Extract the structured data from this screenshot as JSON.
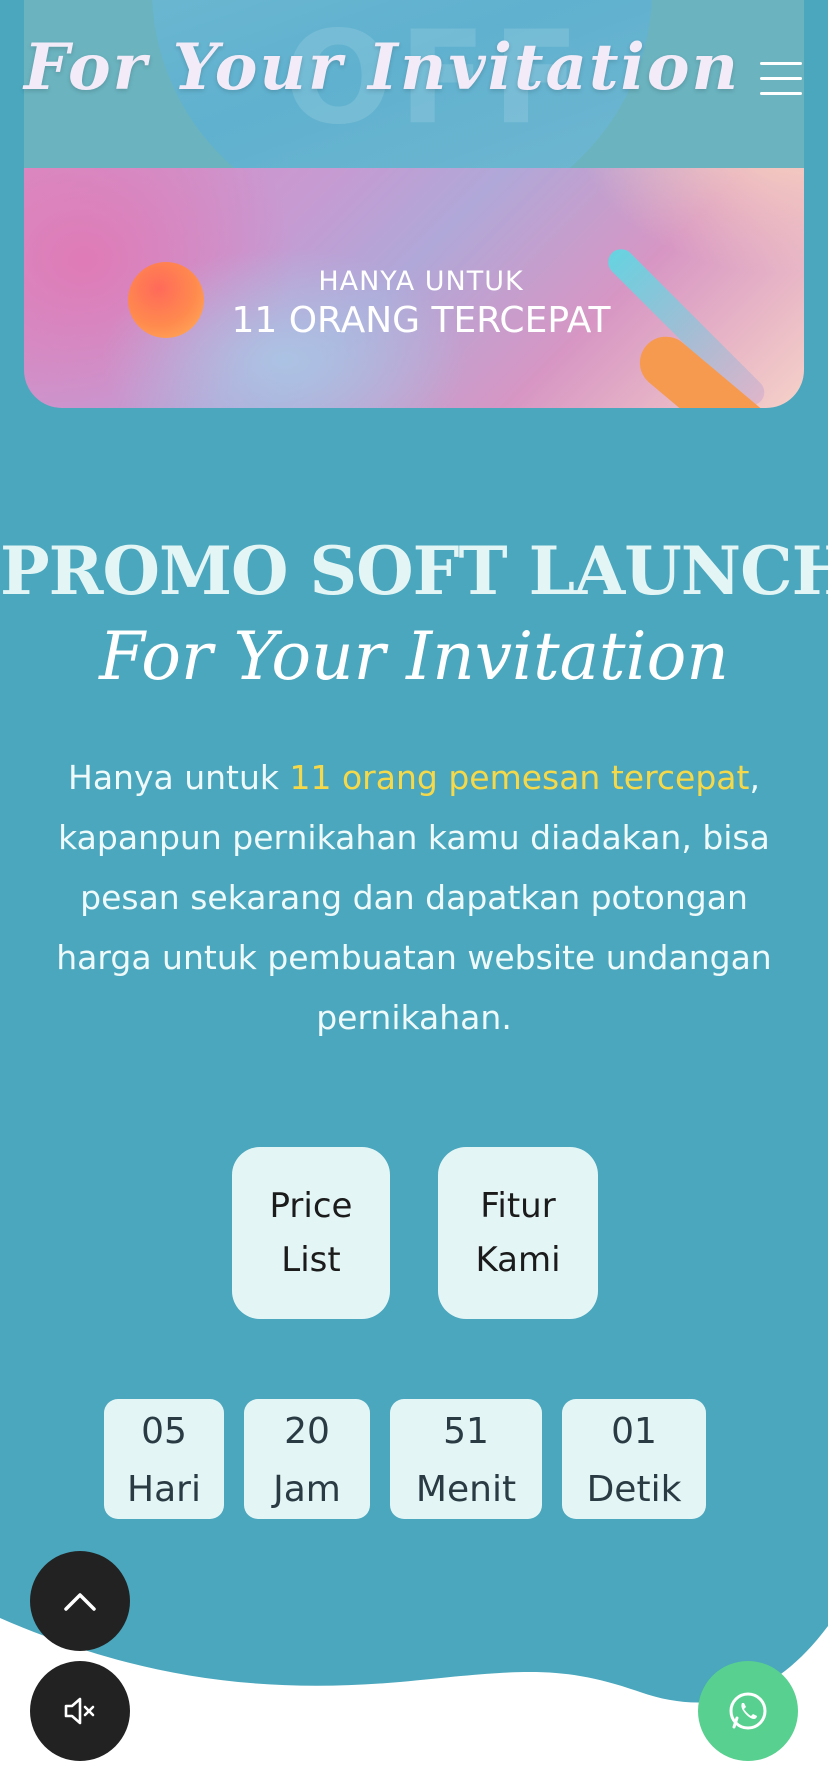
{
  "header": {
    "brand": "For Your Invitation",
    "menu_icon": "hamburger-menu-icon"
  },
  "banner": {
    "background_text": "OFF",
    "small_label": "HANYA UNTUK",
    "big_label": "11 ORANG TERCEPAT"
  },
  "promo": {
    "title": "PROMO SOFT LAUNCH",
    "script": "For Your Invitation",
    "body_prefix": "Hanya untuk ",
    "body_highlight": "11 orang pemesan tercepat",
    "body_suffix": ", kapanpun pernikahan kamu diadakan, bisa pesan sekarang dan dapatkan potongan harga untuk pembuatan website undangan pernikahan."
  },
  "buttons": {
    "price_line1": "Price",
    "price_line2": "List",
    "fitur_line1": "Fitur",
    "fitur_line2": "Kami"
  },
  "countdown": [
    {
      "value": "05",
      "label": "Hari"
    },
    {
      "value": "20",
      "label": "Jam"
    },
    {
      "value": "51",
      "label": "Menit"
    },
    {
      "value": "01",
      "label": "Detik"
    }
  ],
  "floating": {
    "scroll_top_icon": "chevron-up-icon",
    "mute_icon": "speaker-muted-icon",
    "whatsapp_icon": "whatsapp-icon"
  },
  "colors": {
    "background": "#4aa7bd",
    "highlight": "#f5d94a",
    "card": "#e4f5f6",
    "whatsapp": "#58d08f",
    "fab_dark": "#222222"
  }
}
